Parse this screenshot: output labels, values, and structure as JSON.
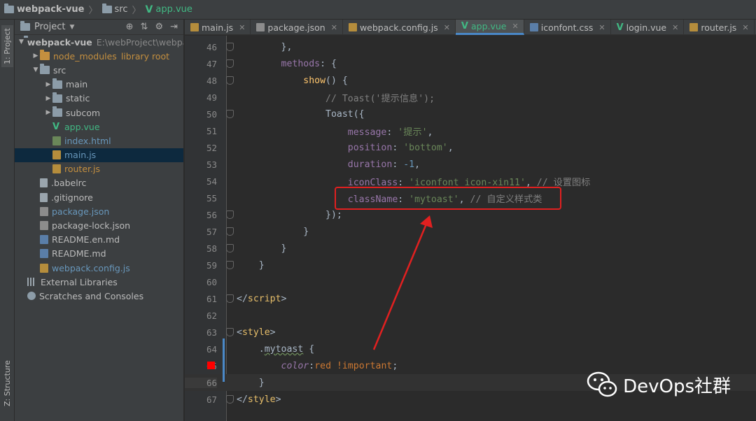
{
  "breadcrumb": {
    "project": "webpack-vue",
    "folder": "src",
    "file": "app.vue"
  },
  "left_strip": {
    "project_tab": "1: Project",
    "structure_tab": "Z: Structure"
  },
  "project_panel": {
    "title": "Project",
    "tree": [
      {
        "label": "webpack-vue",
        "extra": "E:\\webProject\\webpack",
        "type": "root",
        "depth": 0,
        "arrow": "open"
      },
      {
        "label": "node_modules",
        "extra": "library root",
        "type": "folder-excluded",
        "depth": 1,
        "arrow": "closed"
      },
      {
        "label": "src",
        "type": "folder",
        "depth": 1,
        "arrow": "open"
      },
      {
        "label": "main",
        "type": "folder",
        "depth": 2,
        "arrow": "closed"
      },
      {
        "label": "static",
        "type": "folder",
        "depth": 2,
        "arrow": "closed"
      },
      {
        "label": "subcom",
        "type": "folder",
        "depth": 2,
        "arrow": "closed"
      },
      {
        "label": "app.vue",
        "type": "vue",
        "depth": 2
      },
      {
        "label": "index.html",
        "type": "html",
        "depth": 2
      },
      {
        "label": "main.js",
        "type": "js",
        "depth": 2,
        "selected": true
      },
      {
        "label": "router.js",
        "type": "js-orange",
        "depth": 2
      },
      {
        "label": ".babelrc",
        "type": "file",
        "depth": 1
      },
      {
        "label": ".gitignore",
        "type": "file",
        "depth": 1
      },
      {
        "label": "package.json",
        "type": "json",
        "depth": 1
      },
      {
        "label": "package-lock.json",
        "type": "json-plain",
        "depth": 1
      },
      {
        "label": "README.en.md",
        "type": "md",
        "depth": 1
      },
      {
        "label": "README.md",
        "type": "md",
        "depth": 1
      },
      {
        "label": "webpack.config.js",
        "type": "js-blue",
        "depth": 1
      },
      {
        "label": "External Libraries",
        "type": "lib",
        "depth": 0
      },
      {
        "label": "Scratches and Consoles",
        "type": "scratch",
        "depth": 0
      }
    ]
  },
  "tabs": [
    {
      "label": "main.js",
      "icon": "js"
    },
    {
      "label": "package.json",
      "icon": "json"
    },
    {
      "label": "webpack.config.js",
      "icon": "js"
    },
    {
      "label": "app.vue",
      "icon": "vue",
      "active": true
    },
    {
      "label": "iconfont.css",
      "icon": "css"
    },
    {
      "label": "login.vue",
      "icon": "vue"
    },
    {
      "label": "router.js",
      "icon": "js"
    }
  ],
  "editor": {
    "current_line": 66,
    "breakpoint_line": 65,
    "lines": [
      {
        "n": "46",
        "tokens": [
          [
            "p",
            "        },"
          ]
        ]
      },
      {
        "n": "47",
        "tokens": [
          [
            "p",
            "        "
          ],
          [
            "prop",
            "methods"
          ],
          [
            "p",
            ": {"
          ]
        ]
      },
      {
        "n": "48",
        "tokens": [
          [
            "p",
            "            "
          ],
          [
            "fn",
            "show"
          ],
          [
            "p",
            "() {"
          ]
        ]
      },
      {
        "n": "49",
        "tokens": [
          [
            "p",
            "                "
          ],
          [
            "cmt",
            "// Toast('提示信息');"
          ]
        ]
      },
      {
        "n": "50",
        "tokens": [
          [
            "p",
            "                Toast({"
          ]
        ]
      },
      {
        "n": "51",
        "tokens": [
          [
            "p",
            "                    "
          ],
          [
            "prop",
            "message"
          ],
          [
            "p",
            ": "
          ],
          [
            "str",
            "'提示'"
          ],
          [
            "p",
            ","
          ]
        ]
      },
      {
        "n": "52",
        "tokens": [
          [
            "p",
            "                    "
          ],
          [
            "prop",
            "position"
          ],
          [
            "p",
            ": "
          ],
          [
            "str",
            "'bottom'"
          ],
          [
            "p",
            ","
          ]
        ]
      },
      {
        "n": "53",
        "tokens": [
          [
            "p",
            "                    "
          ],
          [
            "prop",
            "duration"
          ],
          [
            "p",
            ": "
          ],
          [
            "num",
            "-1"
          ],
          [
            "p",
            ","
          ]
        ]
      },
      {
        "n": "54",
        "tokens": [
          [
            "p",
            "                    "
          ],
          [
            "prop",
            "iconClass"
          ],
          [
            "p",
            ": "
          ],
          [
            "str",
            "'iconfont icon-xin11'"
          ],
          [
            "p",
            ", "
          ],
          [
            "cmt",
            "// 设置图标"
          ]
        ]
      },
      {
        "n": "55",
        "tokens": [
          [
            "p",
            "                    "
          ],
          [
            "prop",
            "className"
          ],
          [
            "p",
            ": "
          ],
          [
            "str",
            "'mytoast'"
          ],
          [
            "p",
            ", "
          ],
          [
            "cmt",
            "// 自定义样式类"
          ]
        ]
      },
      {
        "n": "56",
        "tokens": [
          [
            "p",
            "                });"
          ]
        ]
      },
      {
        "n": "57",
        "tokens": [
          [
            "p",
            "            }"
          ]
        ]
      },
      {
        "n": "58",
        "tokens": [
          [
            "p",
            "        }"
          ]
        ]
      },
      {
        "n": "59",
        "tokens": [
          [
            "p",
            "    }"
          ]
        ]
      },
      {
        "n": "60",
        "tokens": []
      },
      {
        "n": "61",
        "tokens": [
          [
            "p",
            "</"
          ],
          [
            "tag",
            "script"
          ],
          [
            "p",
            ">"
          ]
        ]
      },
      {
        "n": "62",
        "tokens": []
      },
      {
        "n": "63",
        "tokens": [
          [
            "p",
            "<"
          ],
          [
            "tag",
            "style"
          ],
          [
            "p",
            ">"
          ]
        ]
      },
      {
        "n": "64",
        "tokens": [
          [
            "p",
            "    ."
          ],
          [
            "sel",
            "mytoast"
          ],
          [
            "p",
            " {"
          ]
        ]
      },
      {
        "n": "65",
        "tokens": [
          [
            "p",
            "        "
          ],
          [
            "css-prop",
            "color"
          ],
          [
            "p",
            ":"
          ],
          [
            "kw",
            "red !important"
          ],
          [
            "p",
            ";"
          ]
        ]
      },
      {
        "n": "66",
        "tokens": [
          [
            "p",
            "    }"
          ]
        ]
      },
      {
        "n": "67",
        "tokens": [
          [
            "p",
            "</"
          ],
          [
            "tag",
            "style"
          ],
          [
            "p",
            ">"
          ]
        ]
      }
    ]
  },
  "watermark": {
    "text": "DevOps社群"
  },
  "colors": {
    "highlight": "#e12020",
    "accent": "#4a88c7",
    "vue_green": "#41b883"
  }
}
